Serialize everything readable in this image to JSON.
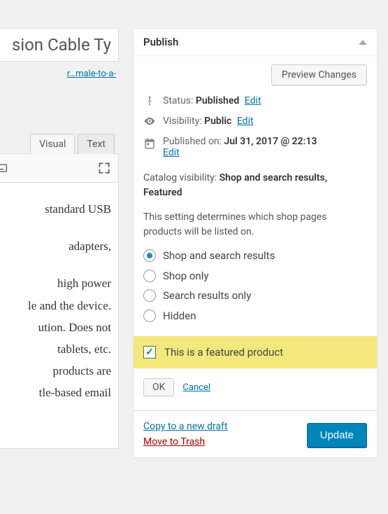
{
  "editor": {
    "title_fragment": "sion Cable Ty",
    "permalink_fragment": "r…male-to-a-",
    "tabs": {
      "visual": "Visual",
      "text": "Text"
    },
    "content_lines": [
      " standard USB",
      " adapters,",
      "high power",
      "le and the device.",
      "ution. Does not",
      "tablets, etc.",
      " products are",
      "tle-based email"
    ]
  },
  "publish": {
    "header": "Publish",
    "preview_btn": "Preview Changes",
    "status": {
      "label": "Status:",
      "value": "Published",
      "edit": "Edit"
    },
    "visibility": {
      "label": "Visibility:",
      "value": "Public",
      "edit": "Edit"
    },
    "published": {
      "label": "Published on:",
      "value": "Jul 31, 2017 @ 22:13",
      "edit": "Edit"
    },
    "catalog": {
      "label": "Catalog visibility:",
      "value": "Shop and search results, Featured",
      "desc": "This setting determines which shop pages products will be listed on.",
      "options": [
        "Shop and search results",
        "Shop only",
        "Search results only",
        "Hidden"
      ],
      "selected_index": 0,
      "featured_label": "This is a featured product",
      "featured_checked": true,
      "ok": "OK",
      "cancel": "Cancel"
    },
    "copy_link": "Copy to a new draft",
    "trash_link": "Move to Trash",
    "update_btn": "Update"
  }
}
